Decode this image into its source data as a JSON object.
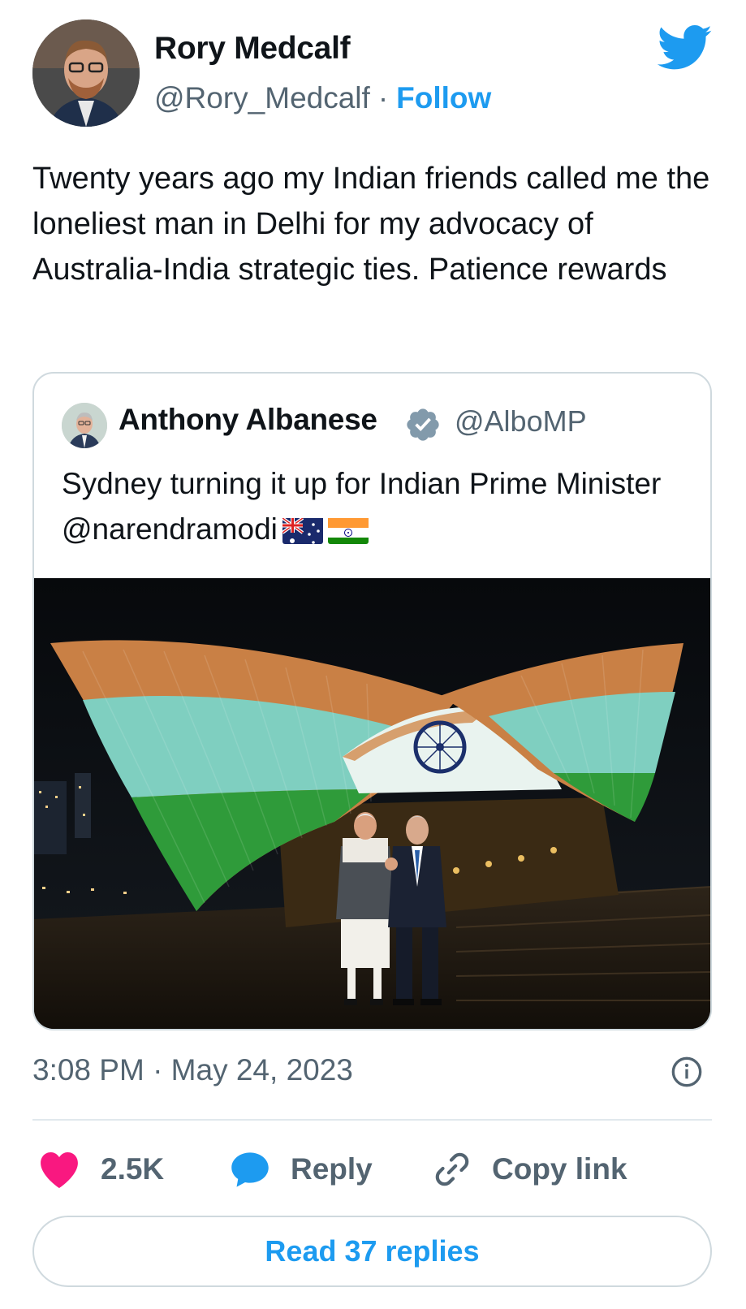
{
  "author": {
    "name": "Rory Medcalf",
    "handle": "@Rory_Medcalf",
    "separator": "·",
    "follow_label": "Follow"
  },
  "tweet": {
    "text": "Twenty years ago my Indian friends called me the loneliest man in Delhi for my advocacy of Australia-India strategic ties. Patience rewards",
    "timestamp": "3:08 PM · May 24, 2023"
  },
  "quoted_tweet": {
    "name": "Anthony Albanese",
    "handle": "@AlboMP",
    "text": "Sydney turning it up for Indian Prime Minister @narendramodi",
    "flags": [
      "australia-flag-emoji",
      "india-flag-emoji"
    ],
    "image": "sydney-opera-house-lit-in-indian-flag-colors-with-two-leaders"
  },
  "actions": {
    "like_count": "2.5K",
    "reply_label": "Reply",
    "copy_label": "Copy link",
    "read_replies_label": "Read 37 replies"
  },
  "colors": {
    "accent": "#1d9bf0",
    "like": "#f91880",
    "text": "#0f1419",
    "secondary": "#536471",
    "border": "#cfd9de"
  }
}
